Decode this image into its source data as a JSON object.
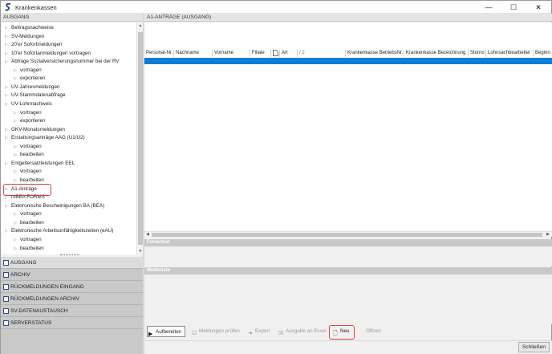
{
  "window": {
    "title": "Krankenkassen",
    "controls": {
      "minimize": "—",
      "maximize": "☐",
      "close": "✕"
    }
  },
  "left": {
    "header": "AUSGANG",
    "tree": [
      "Beitragsnachweise",
      "SV-Meldungen",
      "20'er Sofortmeldungen",
      "10'er Sofortanmeldungen vortragen",
      "Abfrage Sozialversicherungsnummer bei der RV",
      "vortragen",
      "exportieren",
      "UV-Jahresmeldungen",
      "UV-Stammdatenabfrage",
      "UV-Lohnnachweis",
      "vortragen",
      "exportieren",
      "GKV-Monatsmeldungen",
      "Erstattungsanträge AAG (U1/U2)",
      "vortragen",
      "bearbeiten",
      "Entgeltersatzleistungen EEL",
      "vortragen",
      "bearbeiten",
      "A1-Anträge",
      "rvBEA FORMS",
      "Elektronische Bescheinigungen BA (BEA)",
      "vortragen",
      "bearbeiten",
      "Elektronische Arbeitsunfähigkeitszeiten (eAU)",
      "vortragen",
      "bearbeiten"
    ],
    "nav": [
      "AUSGANG",
      "ARCHIV",
      "RÜCKMELDUNGEN EINGANG",
      "RÜCKMELDUNGEN ARCHIV",
      "SV-DATENAUSTAUSCH",
      "SERVERSTATUS"
    ]
  },
  "right": {
    "header": "A1-ANTRÄGE (AUSGANG)",
    "columns": [
      "Personal-Nr.",
      "Nachname",
      "Vorname",
      "Filiale",
      "",
      "Art",
      "/ 2",
      "Krankenkasse BetriebsNr.",
      "Krankenkasse Bezeichnung",
      "Storno",
      "Lohnsachbearbeiter",
      "Beginn"
    ],
    "sections": {
      "error": "Fehlertext",
      "message": "Meldeliste"
    },
    "toolbar": {
      "aufbereiten": "Aufbereiten",
      "pruefen": "Meldungen prüfen",
      "export": "Export",
      "excel": "Ausgabe an Excel",
      "neu": "Neu",
      "oeffnen": "Öffnen"
    },
    "close": "Schließen"
  }
}
